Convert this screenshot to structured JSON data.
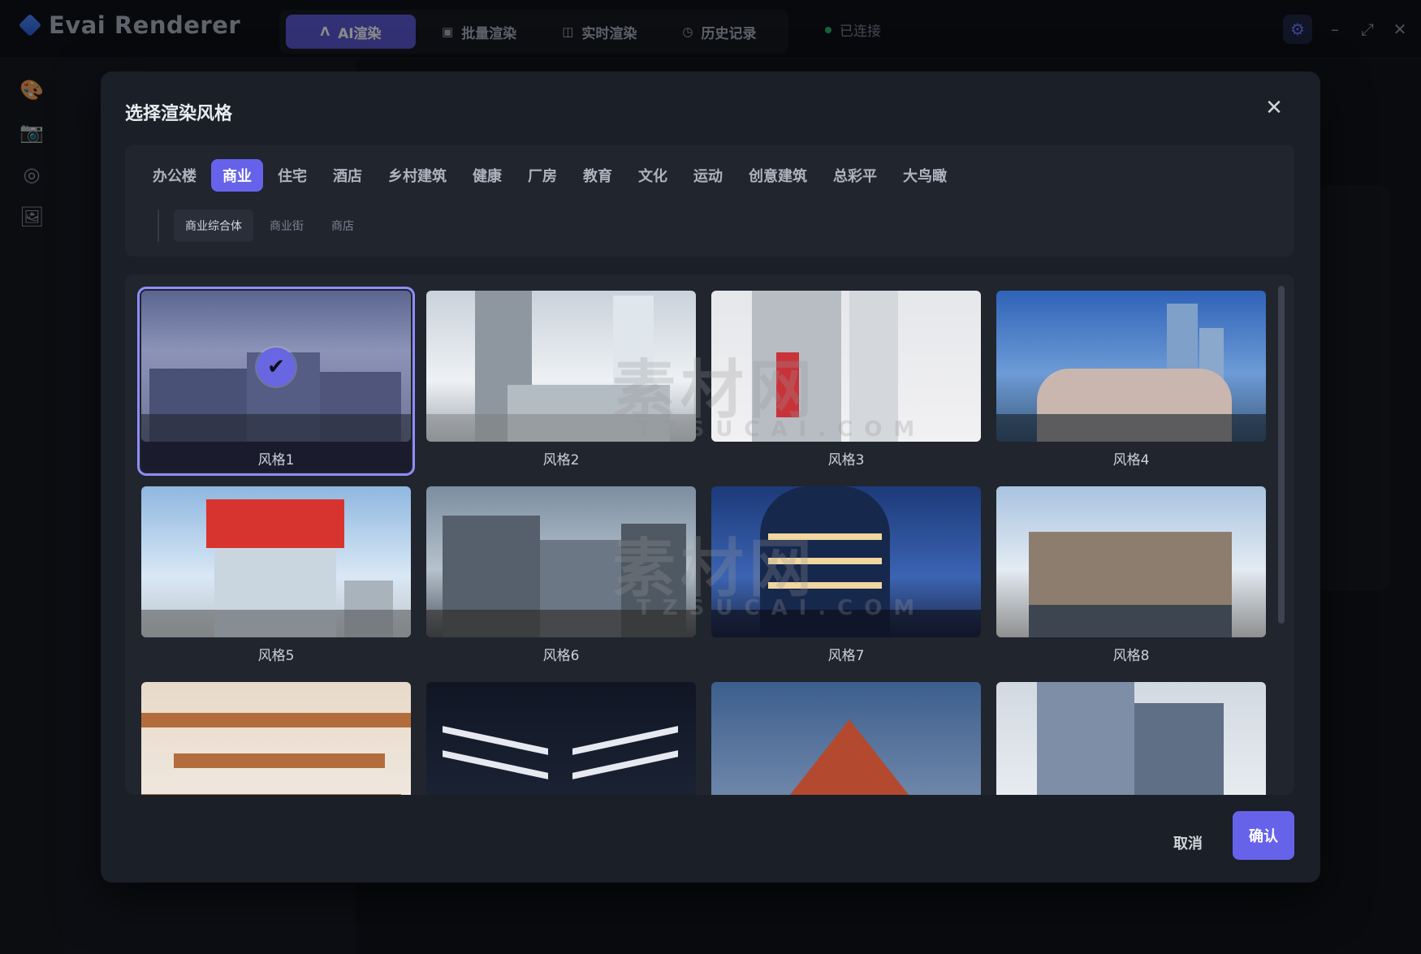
{
  "app": {
    "title": "Evai Renderer"
  },
  "main_tabs": [
    {
      "label": "AI渲染",
      "icon": "ai-icon",
      "active": true
    },
    {
      "label": "批量渲染",
      "icon": "image-icon",
      "active": false
    },
    {
      "label": "实时渲染",
      "icon": "camera-icon",
      "active": false
    },
    {
      "label": "历史记录",
      "icon": "clock-icon",
      "active": false
    }
  ],
  "status": {
    "label": "已连接",
    "color": "#2fb36a"
  },
  "modal": {
    "title": "选择渲染风格",
    "categories": [
      "办公楼",
      "商业",
      "住宅",
      "酒店",
      "乡村建筑",
      "健康",
      "厂房",
      "教育",
      "文化",
      "运动",
      "创意建筑",
      "总彩平",
      "大鸟瞰"
    ],
    "active_category": "商业",
    "subcategories": [
      "商业综合体",
      "商业街",
      "商店"
    ],
    "active_subcategory": "商业综合体",
    "styles": [
      {
        "label": "风格1",
        "selected": true
      },
      {
        "label": "风格2",
        "selected": false
      },
      {
        "label": "风格3",
        "selected": false
      },
      {
        "label": "风格4",
        "selected": false
      },
      {
        "label": "风格5",
        "selected": false
      },
      {
        "label": "风格6",
        "selected": false
      },
      {
        "label": "风格7",
        "selected": false
      },
      {
        "label": "风格8",
        "selected": false
      },
      {
        "label": "",
        "selected": false
      },
      {
        "label": "",
        "selected": false
      },
      {
        "label": "",
        "selected": false
      },
      {
        "label": "",
        "selected": false
      }
    ],
    "cancel_label": "取消",
    "confirm_label": "确认"
  },
  "watermark": {
    "text": "素材网",
    "sub": "TZSUCAI.COM"
  },
  "accent_color": "#6663ea"
}
